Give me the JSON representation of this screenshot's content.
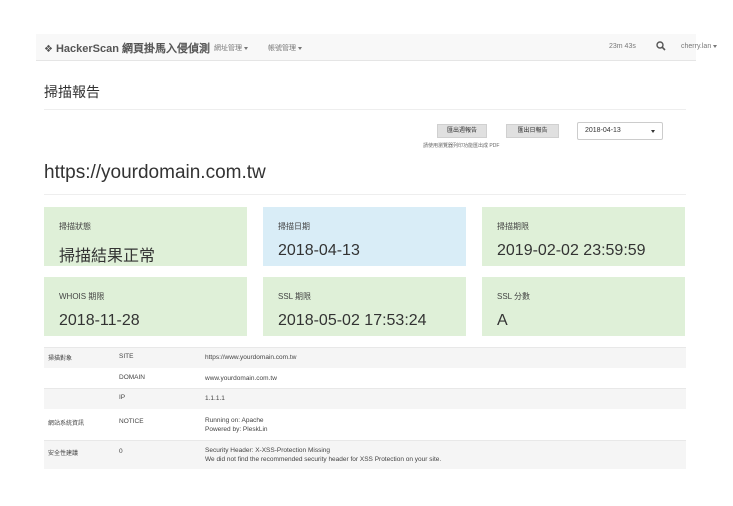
{
  "navbar": {
    "home_icon": "home-icon",
    "brand": "HackerScan 網頁掛馬入侵偵測",
    "menu": [
      {
        "label": "網址管理"
      },
      {
        "label": "帳號管理"
      }
    ],
    "timer": "23m 43s",
    "search_icon": "search-icon",
    "user": "cherry.lan"
  },
  "page": {
    "title": "掃描報告",
    "domain": "https://yourdomain.com.tw"
  },
  "toolbar": {
    "export_week": "匯出週報告",
    "export_day": "匯出日報告",
    "note": "請使用瀏覽器列印功能匯出成 PDF",
    "date_selected": "2018-04-13"
  },
  "cards": [
    {
      "label": "掃描狀態",
      "value": "掃描結果正常",
      "color": "#dff0d8"
    },
    {
      "label": "掃描日期",
      "value": "2018-04-13",
      "color": "#d9edf7"
    },
    {
      "label": "掃描期限",
      "value": "2019-02-02 23:59:59",
      "color": "#dff0d8"
    },
    {
      "label": "WHOIS 期限",
      "value": "2018-11-28",
      "color": "#dff0d8"
    },
    {
      "label": "SSL 期限",
      "value": "2018-05-02 17:53:24",
      "color": "#dff0d8"
    },
    {
      "label": "SSL 分數",
      "value": "A",
      "color": "#dff0d8"
    }
  ],
  "details": [
    {
      "category": "掃描對象",
      "key": "SITE",
      "lines": [
        "https://www.yourdomain.com.tw"
      ]
    },
    {
      "category": "",
      "key": "DOMAIN",
      "lines": [
        "www.yourdomain.com.tw"
      ]
    },
    {
      "category": "",
      "key": "IP",
      "lines": [
        "1.1.1.1"
      ]
    },
    {
      "category": "網站系統資訊",
      "key": "NOTICE",
      "lines": [
        "Running on: Apache",
        "Powered by: PleskLin"
      ]
    },
    {
      "category": "安全性建議",
      "key": "0",
      "lines": [
        "Security Header: X-XSS-Protection Missing",
        "We did not find the recommended security header for XSS Protection on your site."
      ]
    }
  ]
}
